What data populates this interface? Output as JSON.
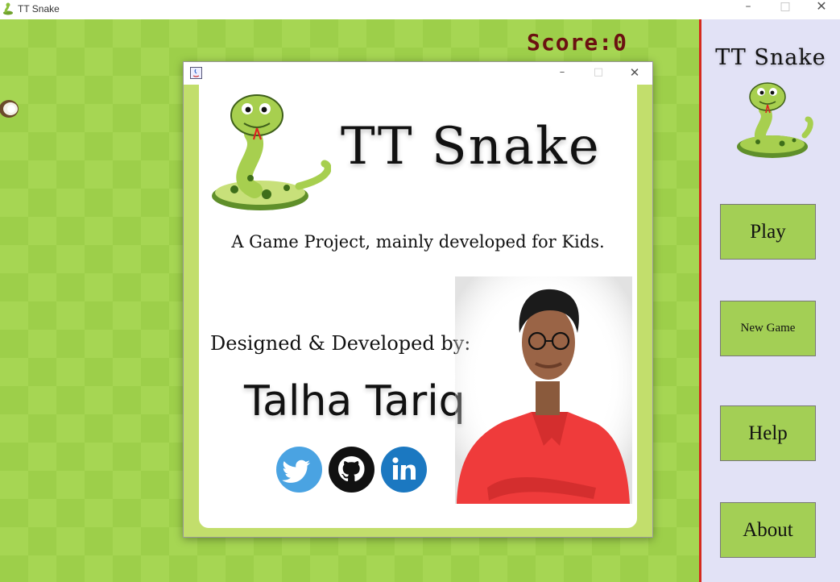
{
  "window": {
    "title": "TT Snake",
    "controls": {
      "minimize": "–",
      "maximize": "□",
      "close": "✕"
    }
  },
  "game": {
    "score_label": "Score:0",
    "food_icon": "coconut-icon",
    "board_colors": {
      "light": "#a6d653",
      "dark": "#9dcf4a"
    }
  },
  "sidebar": {
    "title": "TT Snake",
    "logo_icon": "snake-logo-icon",
    "buttons": [
      {
        "label": "Play"
      },
      {
        "label": "New Game"
      },
      {
        "label": "Help"
      },
      {
        "label": "About"
      }
    ],
    "accent_color": "#d52a1e",
    "button_color": "#a3cf55"
  },
  "about_dialog": {
    "controls": {
      "minimize": "–",
      "maximize": "□",
      "close": "✕"
    },
    "title": "TT Snake",
    "subtitle": "A Game Project, mainly developed for Kids.",
    "credit_label": "Designed & Developed by:",
    "developer_name": "Talha Tariq",
    "social_icons": [
      "twitter-icon",
      "github-icon",
      "linkedin-icon"
    ],
    "border_color": "#c2de6c"
  }
}
